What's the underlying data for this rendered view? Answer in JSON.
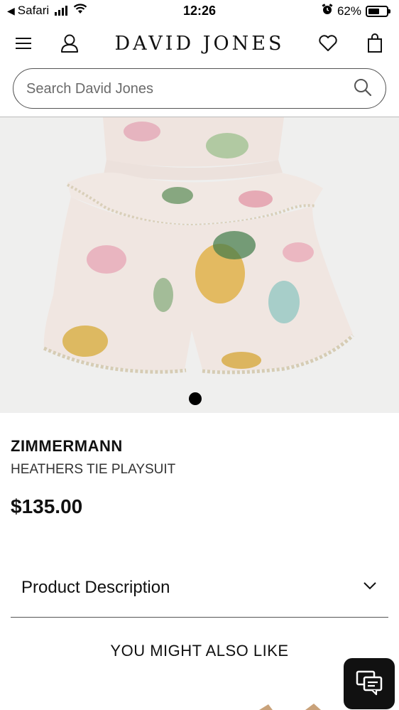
{
  "status_bar": {
    "back_app": "Safari",
    "time": "12:26",
    "battery_percent": "62%",
    "battery_level": 0.62
  },
  "header": {
    "brand": "DAVID JONES",
    "icons": [
      "menu-icon",
      "account-icon",
      "heart-icon",
      "bag-icon"
    ]
  },
  "search": {
    "placeholder": "Search David Jones"
  },
  "product": {
    "brand": "ZIMMERMANN",
    "name": "HEATHERS TIE PLAYSUIT",
    "price": "$135.00",
    "image_count": 1,
    "active_image": 1
  },
  "accordion": {
    "description_label": "Product Description"
  },
  "recommendations": {
    "title": "YOU MIGHT ALSO LIKE"
  },
  "colors": {
    "text": "#111111",
    "image_bg": "#efefee",
    "chat_bg": "#111111"
  }
}
